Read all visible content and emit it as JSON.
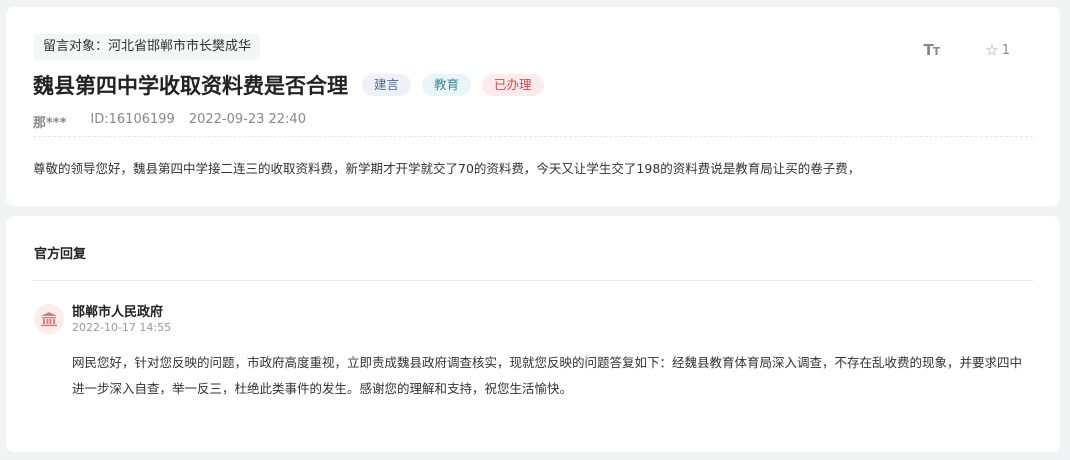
{
  "message": {
    "target_label": "留言对象：河北省邯郸市市长樊成华",
    "toolbar": {
      "font_size_icon": "font-size-icon",
      "star_icon": "star-icon",
      "star_count": "1"
    },
    "title": "魏县第四中学收取资料费是否合理",
    "tags": {
      "type": "建言",
      "category": "教育",
      "status": "已办理"
    },
    "author": "那***",
    "id_label": "ID:16106199",
    "datetime": "2022-09-23 22:40",
    "content": "尊敬的领导您好，魏县第四中学接二连三的收取资料费，新学期才开学就交了70的资料费，今天又让学生交了198的资料费说是教育局让买的卷子费，"
  },
  "reply": {
    "section_title": "官方回复",
    "department": "邯郸市人民政府",
    "datetime": "2022-10-17 14:55",
    "content": "网民您好，针对您反映的问题，市政府高度重视，立即责成魏县政府调查核实，现就您反映的问题答复如下：经魏县教育体育局深入调查，不存在乱收费的现象，并要求四中进一步深入自查，举一反三，杜绝此类事件的发生。感谢您的理解和支持，祝您生活愉快。"
  },
  "colors": {
    "status_red": "#d9474b",
    "type_blue": "#4b6a96",
    "category_teal": "#3f8790",
    "avatar_red": "#e0797b"
  }
}
